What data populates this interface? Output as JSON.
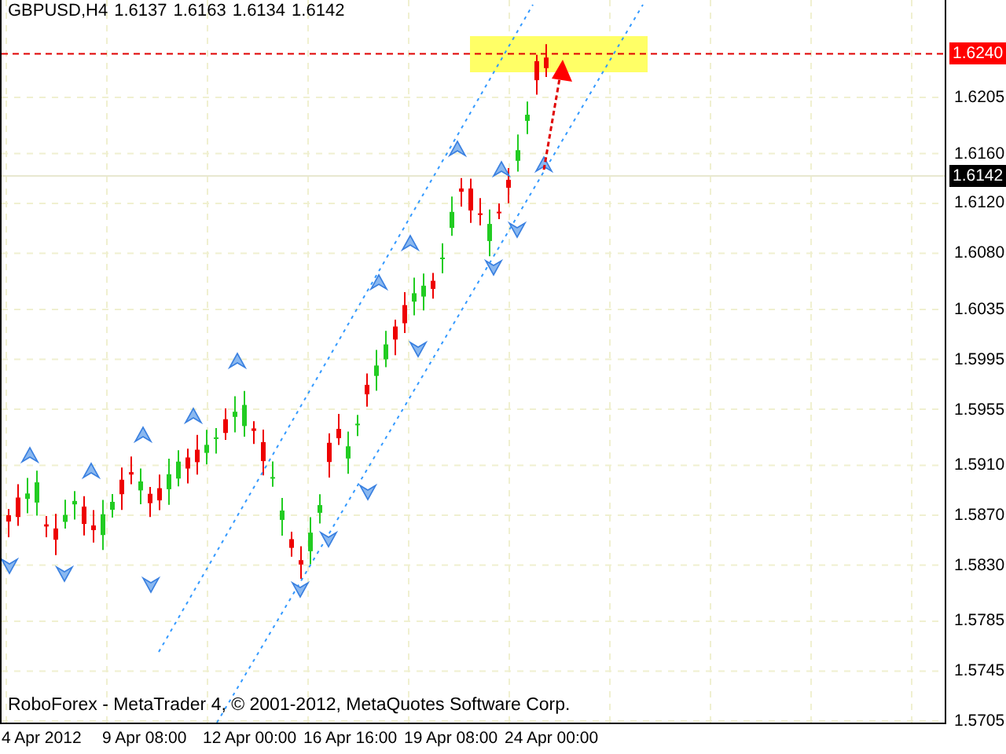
{
  "chart_window": {
    "symbol": "GBPUSD,H4",
    "ohlc": [
      "1.6137",
      "1.6163",
      "1.6134",
      "1.6142"
    ],
    "footer": "RoboForex - MetaTrader 4, © 2001-2012, MetaQuotes Software Corp.",
    "price_axis": [
      "1.6205",
      "1.6160",
      "1.6120",
      "1.6080",
      "1.6035",
      "1.5995",
      "1.5955",
      "1.5910",
      "1.5870",
      "1.5830",
      "1.5785",
      "1.5745",
      "1.5705"
    ],
    "price_markers": [
      {
        "kind": "level",
        "label": "1.6240"
      },
      {
        "kind": "bid",
        "label": "1.6142"
      }
    ],
    "time_axis": [
      "4 Apr 2012",
      "9 Apr 08:00",
      "12 Apr 00:00",
      "16 Apr 16:00",
      "19 Apr 08:00",
      "24 Apr 00:00"
    ]
  }
}
